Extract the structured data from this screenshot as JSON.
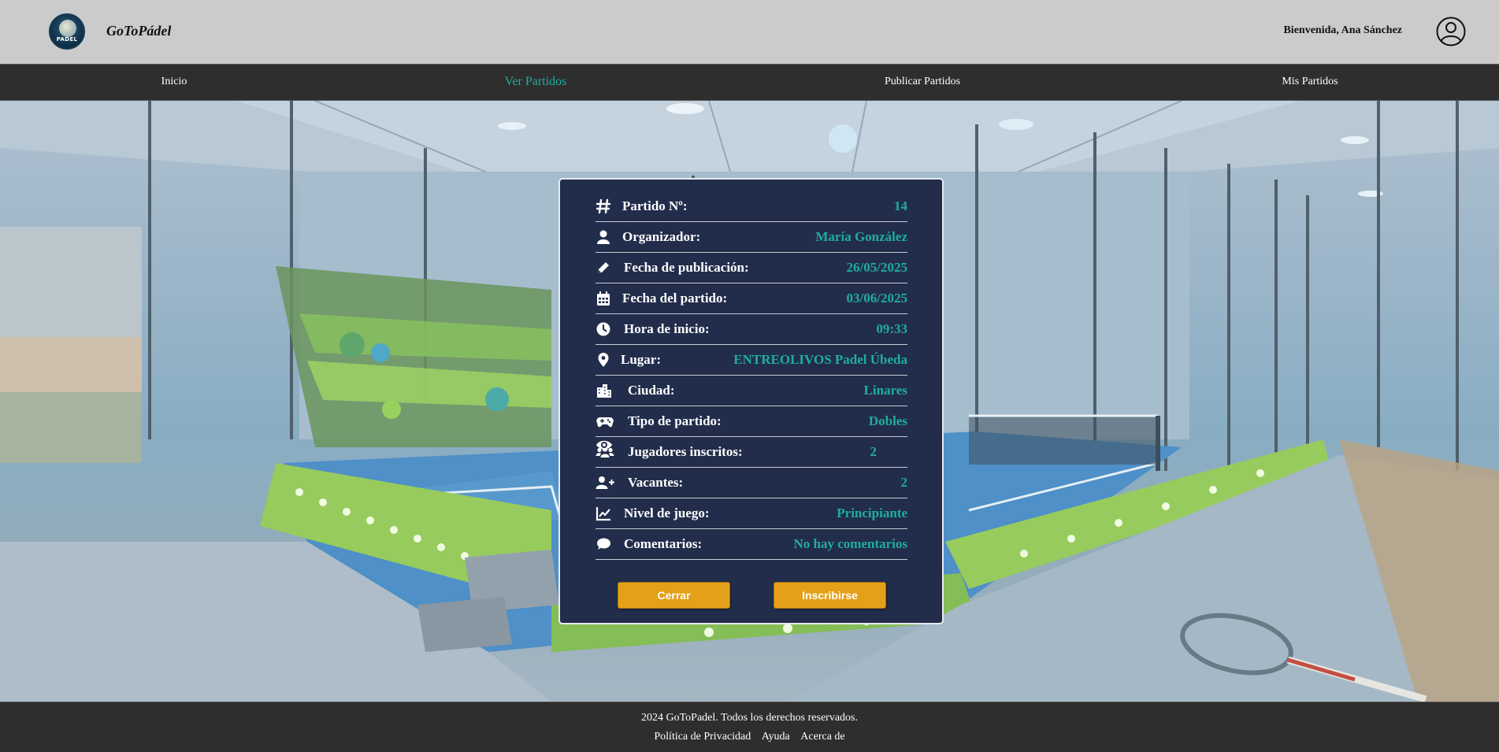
{
  "header": {
    "logo_text": "PADEL",
    "brand": "GoToPádel",
    "welcome": "Bienvenida, Ana Sánchez",
    "user_icon": "user-circle-icon"
  },
  "nav": {
    "items": [
      "Inicio",
      "Ver Partidos",
      "Publicar Partidos",
      "Mis Partidos"
    ],
    "active": "Ver Partidos"
  },
  "match": {
    "rows": [
      {
        "icon": "hash-icon",
        "label": "Partido Nº:",
        "value": "14"
      },
      {
        "icon": "user-icon",
        "label": "Organizador:",
        "value": "María González"
      },
      {
        "icon": "pencil-icon",
        "label": "Fecha de publicación:",
        "value": "26/05/2025"
      },
      {
        "icon": "calendar-icon",
        "label": "Fecha del partido:",
        "value": "03/06/2025"
      },
      {
        "icon": "clock-icon",
        "label": "Hora de inicio:",
        "value": "09:33"
      },
      {
        "icon": "map-pin-icon",
        "label": "Lugar:",
        "value": "ENTREOLIVOS Padel Úbeda"
      },
      {
        "icon": "city-icon",
        "label": "Ciudad:",
        "value": "Linares"
      },
      {
        "icon": "gamepad-icon",
        "label": "Tipo de partido:",
        "value": "Dobles"
      },
      {
        "icon": "users-icon",
        "label": "Jugadores inscritos:",
        "value": "2"
      },
      {
        "icon": "user-plus-icon",
        "label": "Vacantes:",
        "value": "2"
      },
      {
        "icon": "chart-line-icon",
        "label": "Nivel de juego:",
        "value": "Principiante"
      },
      {
        "icon": "comment-icon",
        "label": "Comentarios:",
        "value": "No hay comentarios"
      }
    ],
    "close_label": "Cerrar",
    "join_label": "Inscribirse"
  },
  "footer": {
    "copyright": "2024 GoToPadel. Todos los derechos reservados.",
    "links": [
      "Política de Privacidad",
      "Ayuda",
      "Acerca de"
    ]
  },
  "colors": {
    "accent": "#1fae9b",
    "button": "#e4a018",
    "modal_bg": "#222d4b",
    "bar_bg": "#2e2e2e",
    "header_bg": "#cbcbcb"
  }
}
